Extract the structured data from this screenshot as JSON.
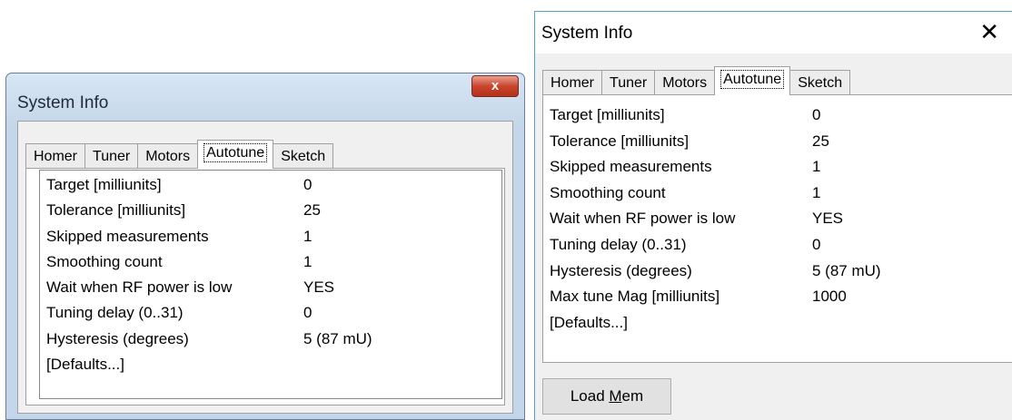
{
  "window_left": {
    "title": "System Info",
    "close_glyph": "x",
    "tabs": [
      "Homer",
      "Tuner",
      "Motors",
      "Autotune",
      "Sketch"
    ],
    "active_tab": "Autotune",
    "rows": [
      {
        "label": "Target [milliunits]",
        "value": "0"
      },
      {
        "label": "Tolerance [milliunits]",
        "value": "25"
      },
      {
        "label": "Skipped measurements",
        "value": "1"
      },
      {
        "label": "Smoothing count",
        "value": "1"
      },
      {
        "label": "Wait when RF power is low",
        "value": "YES"
      },
      {
        "label": "Tuning delay (0..31)",
        "value": "0"
      },
      {
        "label": "Hysteresis (degrees)",
        "value": "5  (87 mU)"
      },
      {
        "label": "[Defaults...]",
        "value": ""
      }
    ]
  },
  "window_right": {
    "title": "System Info",
    "close_glyph": "✕",
    "tabs": [
      "Homer",
      "Tuner",
      "Motors",
      "Autotune",
      "Sketch"
    ],
    "active_tab": "Autotune",
    "rows": [
      {
        "label": "Target [milliunits]",
        "value": "0"
      },
      {
        "label": "Tolerance [milliunits]",
        "value": "25"
      },
      {
        "label": "Skipped measurements",
        "value": "1"
      },
      {
        "label": "Smoothing count",
        "value": "1"
      },
      {
        "label": "Wait when RF power is low",
        "value": "YES"
      },
      {
        "label": "Tuning delay (0..31)",
        "value": "0"
      },
      {
        "label": "Hysteresis (degrees)",
        "value": "5  (87 mU)"
      },
      {
        "label": "Max tune Mag [milliunits]",
        "value": "1000"
      },
      {
        "label": "[Defaults...]",
        "value": ""
      }
    ],
    "button": {
      "label_pre": "Load ",
      "label_mnemonic": "M",
      "label_post": "em"
    }
  },
  "colors": {
    "win7_frame": "#c4d6ea",
    "win7_close": "#c9452c",
    "win10_border": "#5d9ad8",
    "dialog_bg": "#f0f0f0"
  },
  "icons": {
    "close_left": "close-icon",
    "close_right": "close-icon"
  }
}
